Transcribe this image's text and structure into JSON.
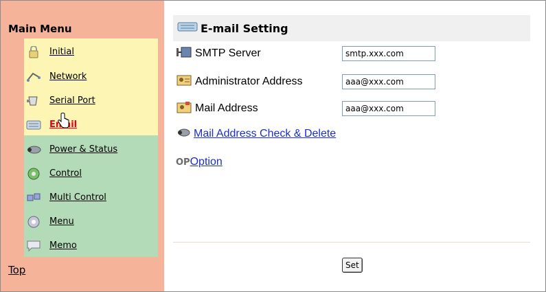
{
  "sidebar": {
    "title": "Main Menu",
    "items": [
      {
        "label": "Initial",
        "icon": "lock-icon"
      },
      {
        "label": "Network",
        "icon": "network-icon"
      },
      {
        "label": "Serial Port",
        "icon": "serial-port-icon"
      },
      {
        "label": "Email",
        "icon": "keyboard-icon",
        "active": true
      },
      {
        "label": "Power & Status",
        "icon": "projector-icon"
      },
      {
        "label": "Control",
        "icon": "control-icon"
      },
      {
        "label": "Multi Control",
        "icon": "multi-control-icon"
      },
      {
        "label": "Menu",
        "icon": "menu-icon"
      },
      {
        "label": "Memo",
        "icon": "memo-icon"
      }
    ],
    "top_link": "Top"
  },
  "main": {
    "title": "E-mail Setting",
    "fields": [
      {
        "label": "SMTP Server",
        "value": "smtp.xxx.com"
      },
      {
        "label": "Administrator Address",
        "value": "aaa@xxx.com"
      },
      {
        "label": "Mail Address",
        "value": "aaa@xxx.com"
      }
    ],
    "check_link": "Mail Address Check & Delete",
    "option_badge": "OP",
    "option_link": "Option",
    "set_label": "Set"
  },
  "colors": {
    "sidebar_bg": "#f5b39a",
    "menu_yellow": "#fdf5b3",
    "menu_green": "#b3dbb8",
    "active_link": "#e8001c",
    "link": "#1a2ec9"
  }
}
